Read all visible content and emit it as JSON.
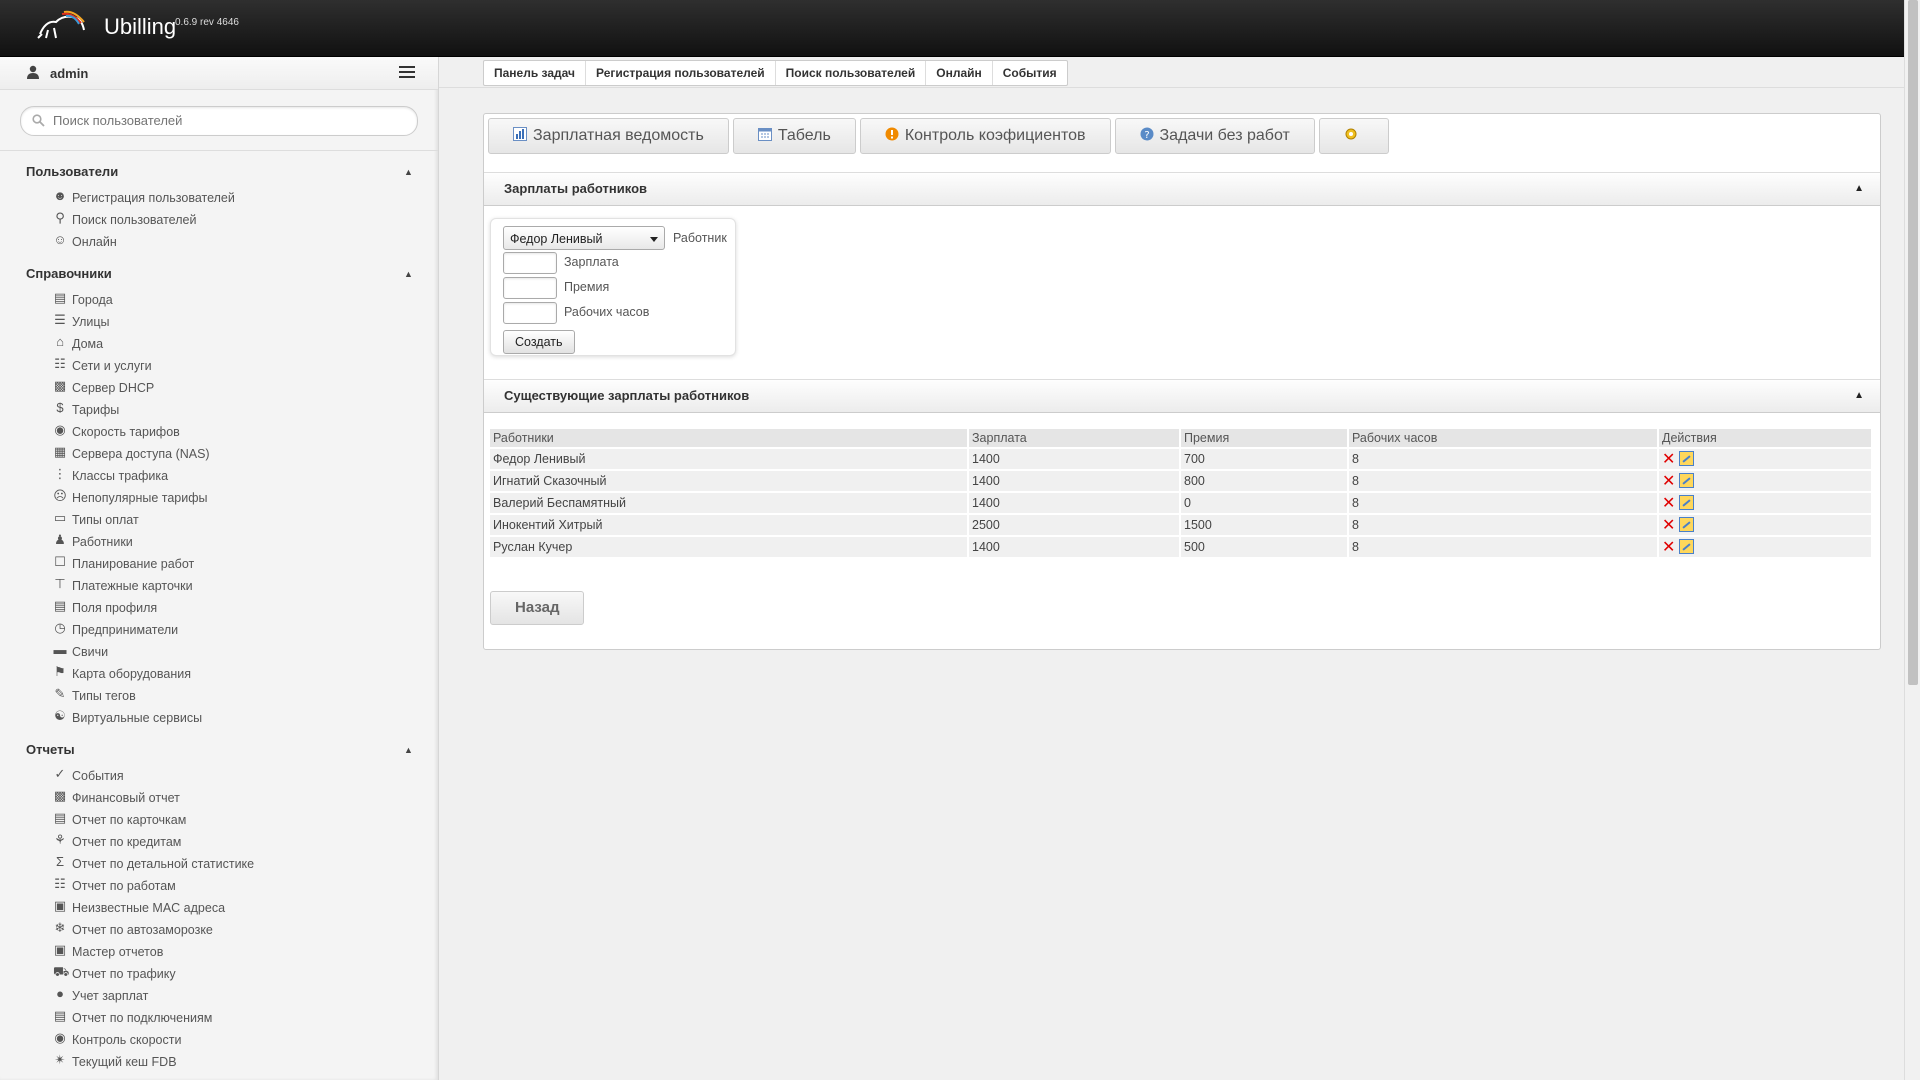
{
  "header": {
    "app_name": "Ubilling",
    "version": "0.6.9 rev 4646"
  },
  "sidebar": {
    "user_name": "admin",
    "search_placeholder": "Поиск пользователей",
    "sections": {
      "users": {
        "title": "Пользователи",
        "items": [
          {
            "label": "Регистрация пользователей",
            "icon": "user-add-icon"
          },
          {
            "label": "Поиск пользователей",
            "icon": "search-icon"
          },
          {
            "label": "Онлайн",
            "icon": "users-online-icon"
          }
        ]
      },
      "directories": {
        "title": "Справочники",
        "items": [
          {
            "label": "Города",
            "icon": "city-icon"
          },
          {
            "label": "Улицы",
            "icon": "street-icon"
          },
          {
            "label": "Дома",
            "icon": "house-icon"
          },
          {
            "label": "Сети и услуги",
            "icon": "network-icon"
          },
          {
            "label": "Сервер DHCP",
            "icon": "server-icon"
          },
          {
            "label": "Тарифы",
            "icon": "dollar-icon"
          },
          {
            "label": "Скорость тарифов",
            "icon": "speed-icon"
          },
          {
            "label": "Сервера доступа (NAS)",
            "icon": "nas-icon"
          },
          {
            "label": "Классы трафика",
            "icon": "traffic-light-icon"
          },
          {
            "label": "Непопулярные тарифы",
            "icon": "unpopular-icon"
          },
          {
            "label": "Типы оплат",
            "icon": "payment-icon"
          },
          {
            "label": "Работники",
            "icon": "worker-icon"
          },
          {
            "label": "Планирование работ",
            "icon": "planning-icon"
          },
          {
            "label": "Платежные карточки",
            "icon": "card-icon"
          },
          {
            "label": "Поля профиля",
            "icon": "profile-fields-icon"
          },
          {
            "label": "Предприниматели",
            "icon": "clock-icon"
          },
          {
            "label": "Свичи",
            "icon": "switch-icon"
          },
          {
            "label": "Карта оборудования",
            "icon": "map-icon"
          },
          {
            "label": "Типы тегов",
            "icon": "tag-icon"
          },
          {
            "label": "Виртуальные сервисы",
            "icon": "virtual-service-icon"
          }
        ]
      },
      "reports": {
        "title": "Отчеты",
        "items": [
          {
            "label": "События",
            "icon": "check-circle-icon"
          },
          {
            "label": "Финансовый отчет",
            "icon": "finance-icon"
          },
          {
            "label": "Отчет по карточкам",
            "icon": "cards-report-icon"
          },
          {
            "label": "Отчет по кредитам",
            "icon": "credit-icon"
          },
          {
            "label": "Отчет по детальной статистике",
            "icon": "sigma-icon"
          },
          {
            "label": "Отчет по работам",
            "icon": "works-icon"
          },
          {
            "label": "Неизвестные MAC адреса",
            "icon": "mac-icon"
          },
          {
            "label": "Отчет по автозаморозке",
            "icon": "snowflake-icon"
          },
          {
            "label": "Мастер отчетов",
            "icon": "wizard-icon"
          },
          {
            "label": "Отчет по трафику",
            "icon": "traffic-icon"
          },
          {
            "label": "Учет зарплат",
            "icon": "salary-icon"
          },
          {
            "label": "Отчет по подключениям",
            "icon": "connections-icon"
          },
          {
            "label": "Контроль скорости",
            "icon": "speed-control-icon"
          },
          {
            "label": "Текущий кеш FDB",
            "icon": "fdb-icon"
          }
        ]
      }
    }
  },
  "breadcrumb": [
    "Панель задач",
    "Регистрация пользователей",
    "Поиск пользователей",
    "Онлайн",
    "События"
  ],
  "tabs": [
    {
      "label": "Зарплатная ведомость",
      "icon": "chart-icon"
    },
    {
      "label": "Табель",
      "icon": "calendar-icon"
    },
    {
      "label": "Контроль коэфициентов",
      "icon": "warning-icon"
    },
    {
      "label": "Задачи без работ",
      "icon": "help-icon"
    },
    {
      "label": "",
      "icon": "settings-icon"
    }
  ],
  "salary_section": {
    "title": "Зарплаты работников",
    "worker_selected": "Федор Ленивый",
    "worker_label": "Работник",
    "salary_label": "Зарплата",
    "bonus_label": "Премия",
    "hours_label": "Рабочих часов",
    "create_button": "Создать"
  },
  "existing_section": {
    "title": "Существующие зарплаты работников",
    "columns": [
      "Работники",
      "Зарплата",
      "Премия",
      "Рабочих часов",
      "Действия"
    ],
    "rows": [
      [
        "Федор Ленивый",
        "1400",
        "700",
        "8"
      ],
      [
        "Игнатий Сказочный",
        "1400",
        "800",
        "8"
      ],
      [
        "Валерий Беспамятный",
        "1400",
        "0",
        "8"
      ],
      [
        "Инокентий Хитрый",
        "2500",
        "1500",
        "8"
      ],
      [
        "Руслан Кучер",
        "1400",
        "500",
        "8"
      ]
    ]
  },
  "back_button": "Назад",
  "colors": {
    "topbar": "#1a1a1a",
    "delete": "#e00000",
    "edit": "#ffd75a"
  }
}
